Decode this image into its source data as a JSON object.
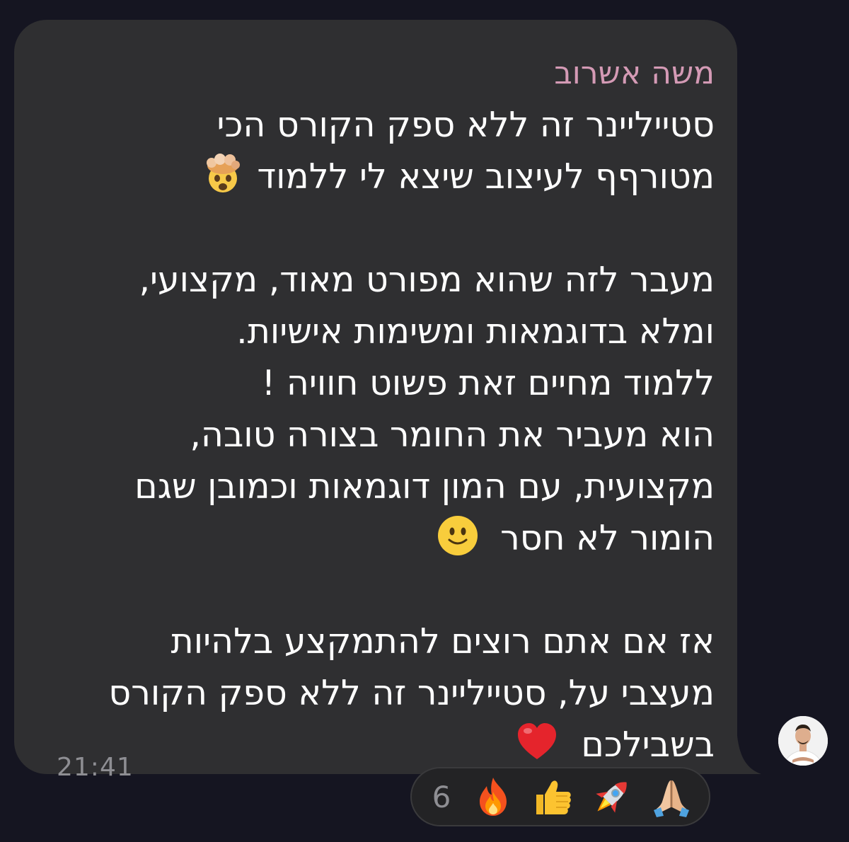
{
  "message": {
    "sender": "משה אשרוב",
    "lines": [
      "סטייליינר זה ללא ספק הקורס הכי",
      "מטורףף לעיצוב שיצא לי ללמוד",
      "",
      "מעבר לזה שהוא מפורט מאוד, מקצועי,",
      "ומלא בדוגמאות ומשימות אישיות.",
      "ללמוד מחיים זאת פשוט חוויה !",
      "הוא מעביר את החומר בצורה טובה,",
      "מקצועית, עם המון דוגמאות וכמובן שגם",
      "הומור לא חסר",
      "",
      "אז אם אתם רוצים להתמקצע בלהיות",
      "מעצבי על, סטייליינר זה ללא ספק הקורס",
      "בשבילכם"
    ],
    "time": "21:41"
  },
  "reactions": {
    "count": "6",
    "items": [
      "fire-icon",
      "thumbs-up-icon",
      "rocket-icon",
      "pray-icon"
    ]
  },
  "colors": {
    "background": "#151521",
    "bubble": "#2f2f31",
    "sender": "#d49ab5",
    "text": "#ffffff",
    "time": "#8e8e93"
  }
}
